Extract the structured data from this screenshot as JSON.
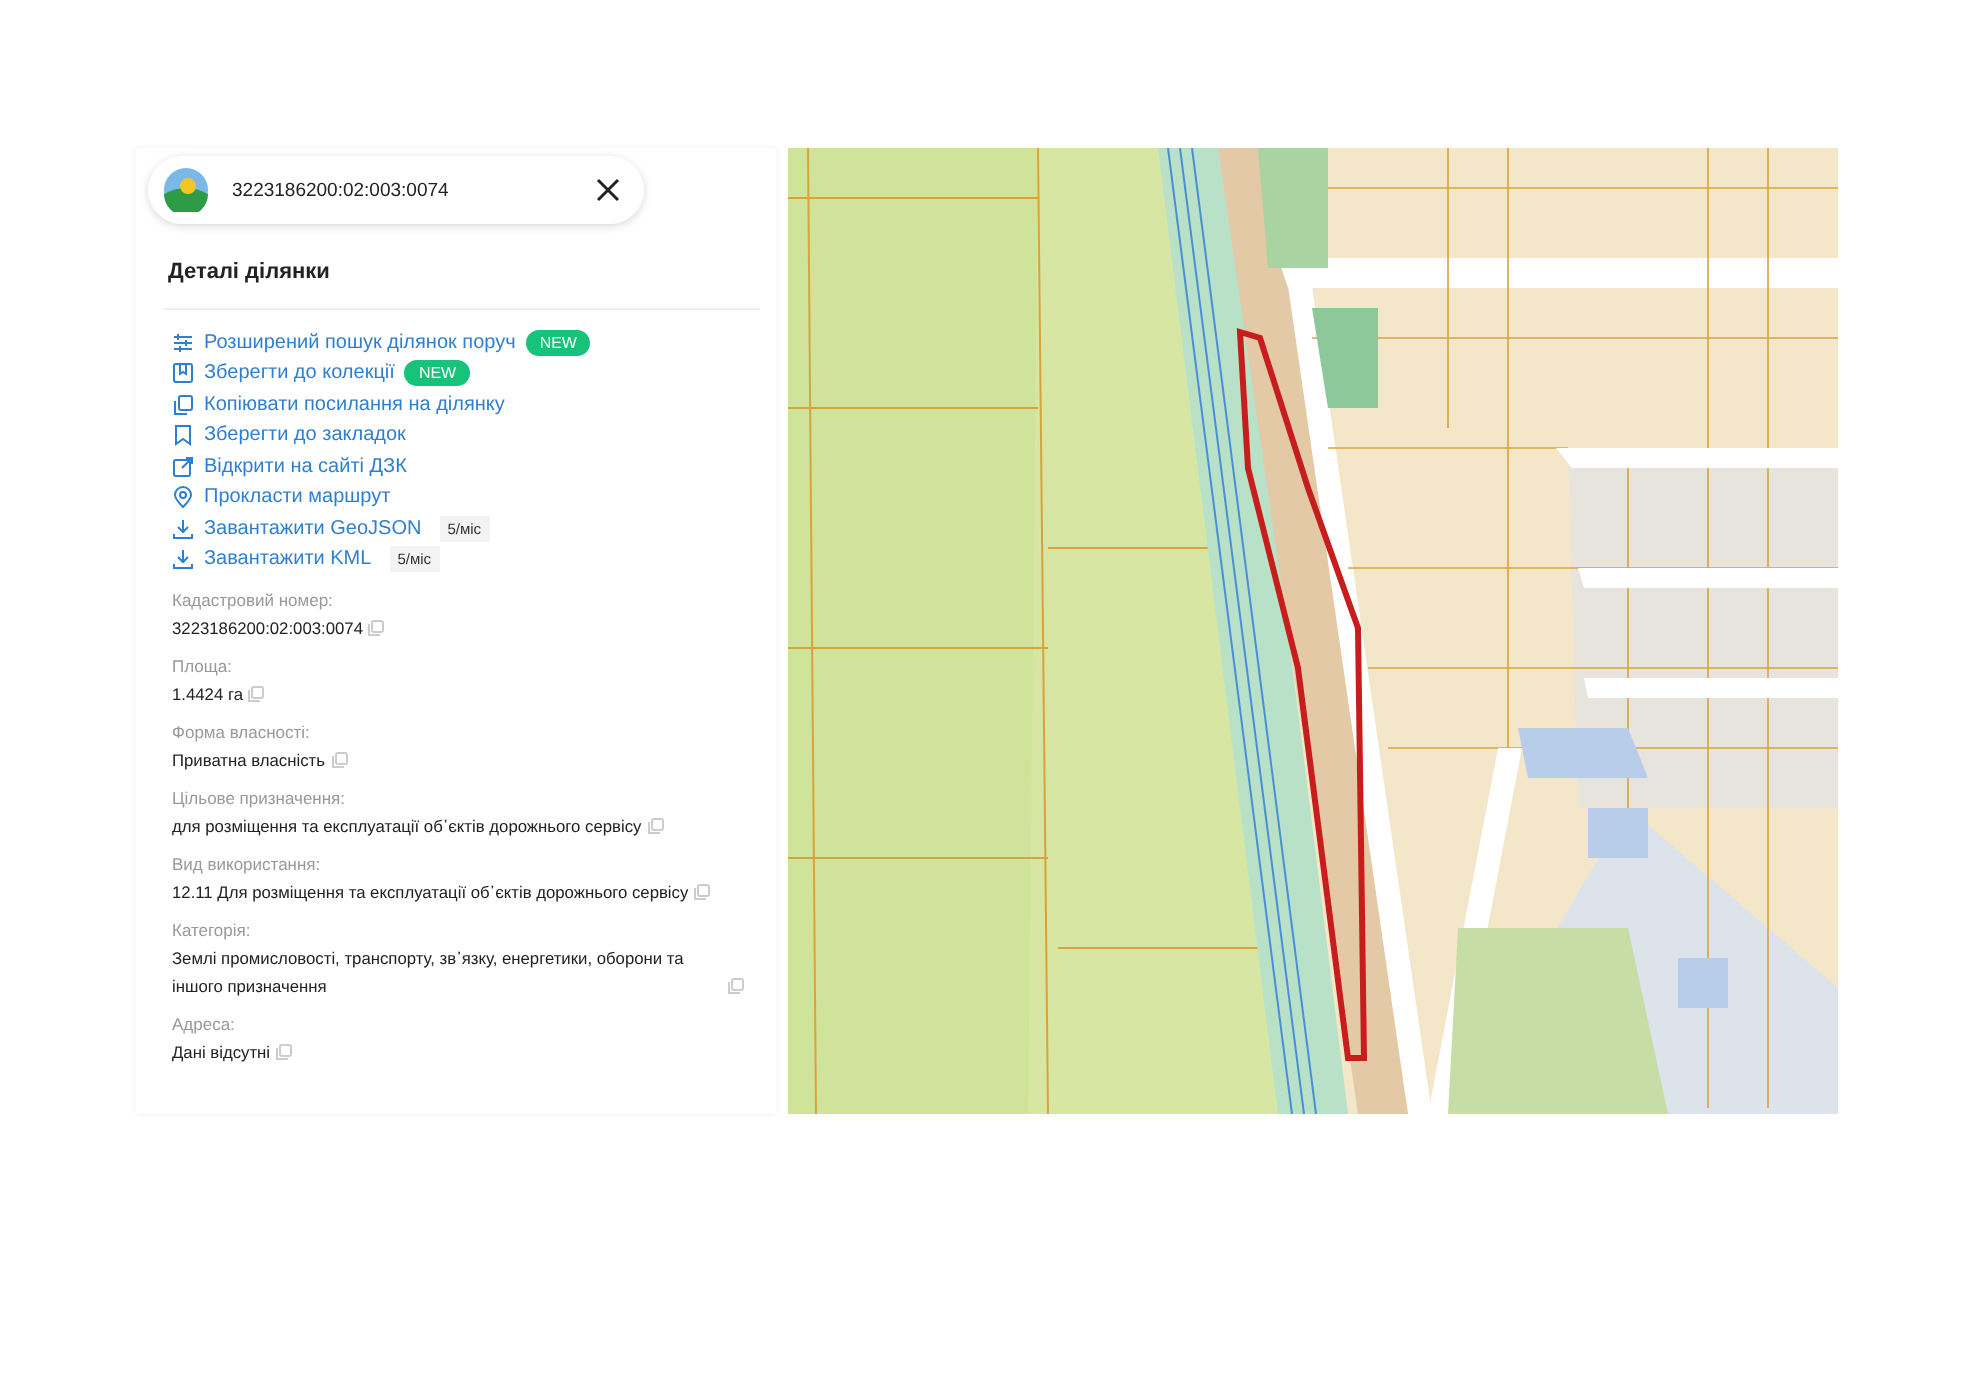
{
  "search": {
    "value": "3223186200:02:003:0074"
  },
  "title": "Деталі ділянки",
  "actions": [
    {
      "kind": "sliders",
      "label": "Розширений пошук ділянок поруч",
      "badge": {
        "kind": "new",
        "text": "NEW"
      }
    },
    {
      "kind": "collection",
      "label": "Зберегти до колекції",
      "badge": {
        "kind": "new",
        "text": "NEW"
      }
    },
    {
      "kind": "copy",
      "label": "Копіювати посилання на ділянку"
    },
    {
      "kind": "bookmark",
      "label": "Зберегти до закладок"
    },
    {
      "kind": "external",
      "label": "Відкрити на сайті ДЗК"
    },
    {
      "kind": "pin",
      "label": "Прокласти маршрут"
    },
    {
      "kind": "download",
      "label": "Завантажити GeoJSON",
      "badge": {
        "kind": "limit",
        "text": "5/міс"
      }
    },
    {
      "kind": "download",
      "label": "Завантажити KML",
      "badge": {
        "kind": "limit",
        "text": "5/міс"
      }
    }
  ],
  "fields": [
    {
      "label": "Кадастровий номер:",
      "value": "3223186200:02:003:0074"
    },
    {
      "label": "Площа:",
      "value": "1.4424 га"
    },
    {
      "label": "Форма власності:",
      "value": "Приватна власність"
    },
    {
      "label": "Цільове призначення:",
      "value": "для розміщення та експлуатації об᾽єктів дорожнього сервісу"
    },
    {
      "label": "Вид використання:",
      "value": "12.11 Для розміщення та експлуатації об᾽єктів дорожнього сервісу"
    },
    {
      "label": "Категорія:",
      "value": "Землі промисловості, транспорту, зв᾽язку, енергетики, оборони та іншого призначення"
    },
    {
      "label": "Адреса:",
      "value": "Дані відсутні"
    }
  ]
}
